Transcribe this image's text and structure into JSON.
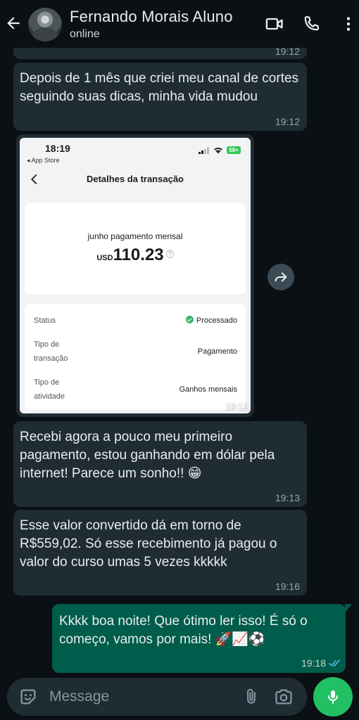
{
  "header": {
    "contact_name": "Fernando Morais Aluno",
    "status": "online"
  },
  "messages": [
    {
      "direction": "in",
      "text": "",
      "time": "19:12",
      "partial": true
    },
    {
      "direction": "in",
      "text": "Depois de 1 mês que criei meu canal de cortes seguindo suas dicas, minha vida mudou",
      "time": "19:12"
    },
    {
      "direction": "in",
      "type": "image",
      "time": "19:12"
    },
    {
      "direction": "in",
      "text": "Recebi agora a pouco meu primeiro pagamento, estou ganhando em dólar pela internet! Parece um sonho!! 😁",
      "time": "19:13"
    },
    {
      "direction": "in",
      "text": "Esse valor convertido dá em torno de R$559,02. Só esse recebimento já pagou o valor do curso umas 5 vezes kkkkk",
      "time": "19:16"
    },
    {
      "direction": "out",
      "text": "Kkkk boa noite! Que ótimo ler isso! É só o começo, vamos por mais! 🚀📈⚽",
      "time": "19:18",
      "read": true
    }
  ],
  "screenshot": {
    "clock": "18:19",
    "back_to": "◂ App Store",
    "battery": "58+",
    "title": "Detalhes da transação",
    "payment_label": "junho pagamento mensal",
    "currency": "USD",
    "amount": "110.23",
    "help_glyph": "?",
    "rows": [
      {
        "label": "Status",
        "value": "Processado"
      },
      {
        "label": "Tipo de transação",
        "value": "Pagamento"
      },
      {
        "label": "Tipo de atividade",
        "value": "Ganhos mensais"
      }
    ]
  },
  "composer": {
    "placeholder": "Message"
  },
  "colors": {
    "background": "#0b1014",
    "incoming_bubble": "#1f2c33",
    "outgoing_bubble": "#005c4b",
    "mic_button": "#21c063",
    "read_ticks": "#53bdeb"
  }
}
